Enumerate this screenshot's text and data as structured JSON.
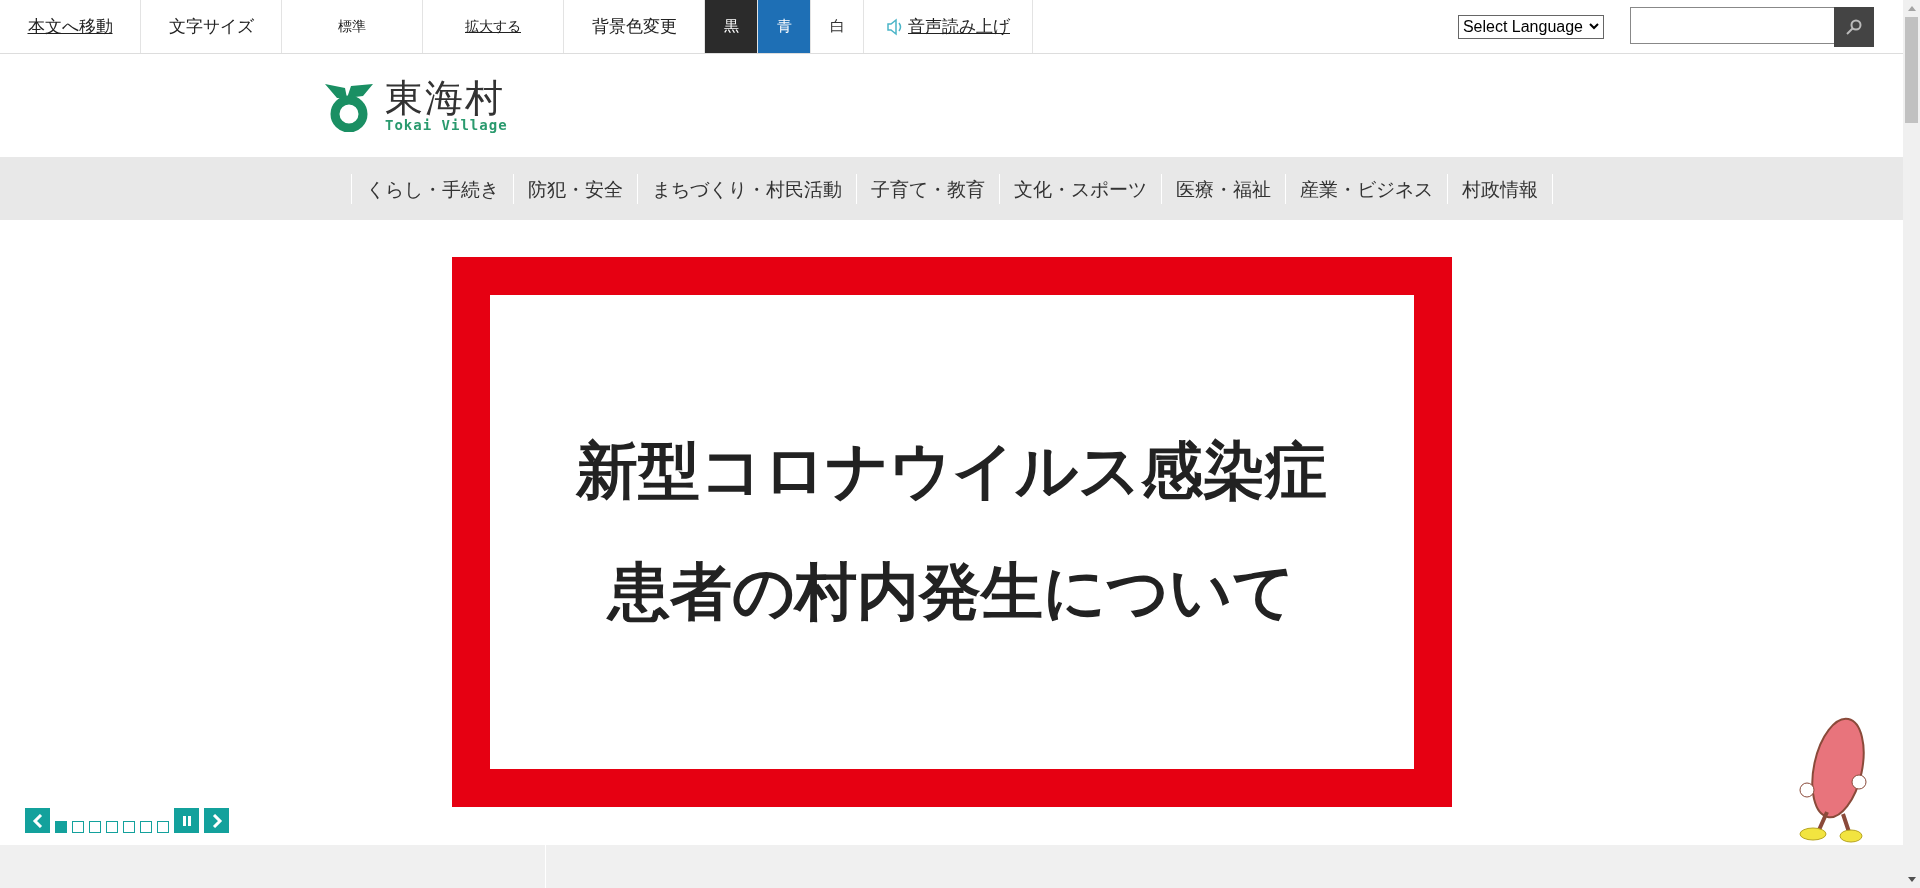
{
  "top_bar": {
    "items": [
      {
        "kind": "link",
        "label": "本文へ移動"
      },
      {
        "kind": "label",
        "label": "文字サイズ"
      },
      {
        "kind": "button",
        "label": "標準"
      },
      {
        "kind": "link",
        "label": "拡大する"
      },
      {
        "kind": "label",
        "label": "背景色変更"
      },
      {
        "kind": "swatch",
        "label": "黒",
        "color": "#2b2b2b"
      },
      {
        "kind": "swatch",
        "label": "青",
        "color": "#1e6fb5"
      },
      {
        "kind": "swatch",
        "label": "白",
        "color": "#ffffff"
      },
      {
        "kind": "speech",
        "label": "音声読み上げ"
      }
    ],
    "language_select": {
      "value": "Select Language"
    }
  },
  "logo": {
    "name": "東海村",
    "subtitle": "Tokai Village"
  },
  "nav": {
    "items": [
      "くらし・手続き",
      "防犯・安全",
      "まちづくり・村民活動",
      "子育て・教育",
      "文化・スポーツ",
      "医療・福祉",
      "産業・ビジネス",
      "村政情報"
    ]
  },
  "banner": {
    "lines": [
      "新型コロナウイルス感染症",
      "患者の村内発生について"
    ]
  },
  "carousel": {
    "slides": [
      {
        "selected": true
      },
      {
        "selected": false
      },
      {
        "selected": false
      },
      {
        "selected": false
      },
      {
        "selected": false
      },
      {
        "selected": false
      },
      {
        "selected": false
      }
    ]
  }
}
